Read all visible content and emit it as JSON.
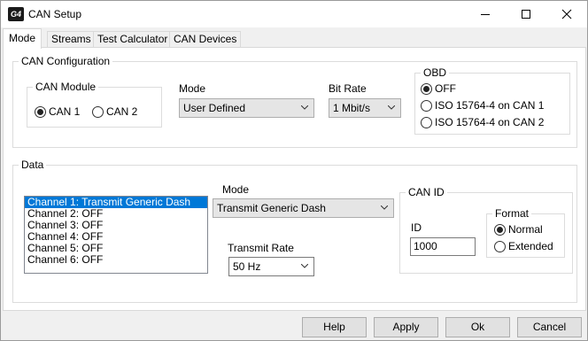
{
  "window": {
    "title": "CAN Setup",
    "logo_text": "G4"
  },
  "tabs": [
    {
      "label": "Mode",
      "active": true
    },
    {
      "label": "Streams",
      "active": false
    },
    {
      "label": "Test Calculator",
      "active": false
    },
    {
      "label": "CAN Devices",
      "active": false
    }
  ],
  "can_config": {
    "title": "CAN Configuration",
    "can_module": {
      "title": "CAN Module",
      "options": [
        {
          "label": "CAN 1",
          "checked": true
        },
        {
          "label": "CAN 2",
          "checked": false
        }
      ]
    },
    "mode": {
      "label": "Mode",
      "value": "User Defined"
    },
    "bit_rate": {
      "label": "Bit Rate",
      "value": "1 Mbit/s"
    },
    "obd": {
      "title": "OBD",
      "options": [
        {
          "label": "OFF",
          "checked": true
        },
        {
          "label": "ISO 15764-4 on CAN 1",
          "checked": false
        },
        {
          "label": "ISO 15764-4 on CAN 2",
          "checked": false
        }
      ]
    }
  },
  "data_section": {
    "title": "Data",
    "channels": [
      {
        "label": "Channel 1: Transmit Generic Dash",
        "selected": true
      },
      {
        "label": "Channel 2: OFF",
        "selected": false
      },
      {
        "label": "Channel 3: OFF",
        "selected": false
      },
      {
        "label": "Channel 4: OFF",
        "selected": false
      },
      {
        "label": "Channel 5: OFF",
        "selected": false
      },
      {
        "label": "Channel 6: OFF",
        "selected": false
      }
    ],
    "mode": {
      "label": "Mode",
      "value": "Transmit Generic Dash"
    },
    "transmit_rate": {
      "label": "Transmit Rate",
      "value": "50 Hz"
    },
    "can_id": {
      "title": "CAN ID",
      "id_label": "ID",
      "id_value": "1000",
      "format": {
        "title": "Format",
        "options": [
          {
            "label": "Normal",
            "checked": true
          },
          {
            "label": "Extended",
            "checked": false
          }
        ]
      }
    }
  },
  "buttons": {
    "help": "Help",
    "apply": "Apply",
    "ok": "Ok",
    "cancel": "Cancel"
  },
  "colors": {
    "selection": "#0078d7",
    "window_bg": "#f0f0f0",
    "panel_bg": "#ffffff"
  },
  "icons": {
    "logo": "app-logo-icon",
    "minimize": "minimize-icon",
    "maximize": "maximize-icon",
    "close": "close-icon",
    "dropdown": "chevron-down-icon"
  }
}
